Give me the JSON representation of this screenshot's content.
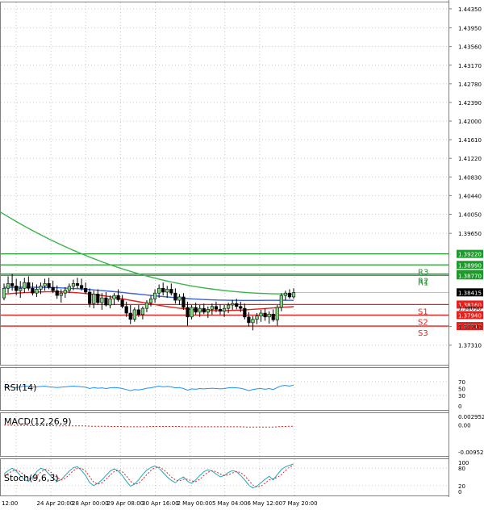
{
  "chart_data": {
    "type": "candlestick",
    "title": "",
    "price_axis": {
      "ylim": [
        1.369,
        1.445
      ],
      "ticks": [
        "1.44350",
        "1.43950",
        "1.43560",
        "1.43170",
        "1.42780",
        "1.42390",
        "1.42000",
        "1.41610",
        "1.41220",
        "1.40830",
        "1.40440",
        "1.40050",
        "1.39650",
        "1.37700",
        "1.37310"
      ]
    },
    "time_axis": {
      "ticks": [
        "12:00",
        "24 Apr 20:00",
        "28 Apr 00:00",
        "29 Apr 08:00",
        "30 Apr 16:00",
        "2 May 00:00",
        "5 May 04:00",
        "6 May 12:00",
        "7 May 20:00"
      ]
    },
    "candles": [
      [
        1.383,
        1.386,
        1.3825,
        1.385
      ],
      [
        1.385,
        1.3875,
        1.384,
        1.386
      ],
      [
        1.386,
        1.388,
        1.3845,
        1.3855
      ],
      [
        1.3855,
        1.387,
        1.3835,
        1.3845
      ],
      [
        1.3845,
        1.3865,
        1.383,
        1.385
      ],
      [
        1.385,
        1.3872,
        1.384,
        1.3862
      ],
      [
        1.3862,
        1.3875,
        1.3845,
        1.385
      ],
      [
        1.385,
        1.3862,
        1.3835,
        1.384
      ],
      [
        1.384,
        1.3858,
        1.3832,
        1.3848
      ],
      [
        1.3848,
        1.3862,
        1.3838,
        1.3855
      ],
      [
        1.3855,
        1.387,
        1.3845,
        1.386
      ],
      [
        1.386,
        1.3872,
        1.3848,
        1.3852
      ],
      [
        1.3852,
        1.3866,
        1.384,
        1.3845
      ],
      [
        1.3845,
        1.3856,
        1.3828,
        1.3835
      ],
      [
        1.3835,
        1.3848,
        1.382,
        1.384
      ],
      [
        1.384,
        1.3852,
        1.383,
        1.3846
      ],
      [
        1.3846,
        1.386,
        1.384,
        1.3854
      ],
      [
        1.3854,
        1.3868,
        1.3846,
        1.386
      ],
      [
        1.386,
        1.3872,
        1.385,
        1.3856
      ],
      [
        1.3856,
        1.387,
        1.3845,
        1.385
      ],
      [
        1.385,
        1.3862,
        1.3838,
        1.3842
      ],
      [
        1.3842,
        1.385,
        1.381,
        1.3818
      ],
      [
        1.3818,
        1.3845,
        1.3808,
        1.3838
      ],
      [
        1.3838,
        1.3848,
        1.3815,
        1.382
      ],
      [
        1.382,
        1.384,
        1.3805,
        1.383
      ],
      [
        1.383,
        1.3842,
        1.3812,
        1.3815
      ],
      [
        1.3815,
        1.3835,
        1.3808,
        1.3828
      ],
      [
        1.3828,
        1.384,
        1.3815,
        1.3835
      ],
      [
        1.3835,
        1.3848,
        1.3822,
        1.3826
      ],
      [
        1.3826,
        1.3836,
        1.3808,
        1.3812
      ],
      [
        1.3812,
        1.3822,
        1.379,
        1.3798
      ],
      [
        1.3798,
        1.3815,
        1.3775,
        1.3785
      ],
      [
        1.3785,
        1.381,
        1.378,
        1.3805
      ],
      [
        1.3805,
        1.3815,
        1.379,
        1.3795
      ],
      [
        1.3795,
        1.3812,
        1.3785,
        1.3808
      ],
      [
        1.3808,
        1.3825,
        1.38,
        1.382
      ],
      [
        1.382,
        1.3835,
        1.3812,
        1.3828
      ],
      [
        1.3828,
        1.3848,
        1.382,
        1.384
      ],
      [
        1.384,
        1.3858,
        1.383,
        1.385
      ],
      [
        1.385,
        1.3862,
        1.3835,
        1.3842
      ],
      [
        1.3842,
        1.3855,
        1.383,
        1.3848
      ],
      [
        1.3848,
        1.386,
        1.3835,
        1.384
      ],
      [
        1.384,
        1.385,
        1.3818,
        1.3825
      ],
      [
        1.3825,
        1.3838,
        1.3815,
        1.3832
      ],
      [
        1.3832,
        1.384,
        1.3805,
        1.381
      ],
      [
        1.381,
        1.3822,
        1.3772,
        1.379
      ],
      [
        1.379,
        1.3815,
        1.3785,
        1.381
      ],
      [
        1.381,
        1.382,
        1.3795,
        1.38
      ],
      [
        1.38,
        1.3815,
        1.379,
        1.3808
      ],
      [
        1.3808,
        1.3818,
        1.3796,
        1.38
      ],
      [
        1.38,
        1.3812,
        1.3788,
        1.3806
      ],
      [
        1.3806,
        1.3818,
        1.3795,
        1.3812
      ],
      [
        1.3812,
        1.3822,
        1.38,
        1.3806
      ],
      [
        1.3806,
        1.3816,
        1.3795,
        1.3802
      ],
      [
        1.3802,
        1.3815,
        1.379,
        1.3808
      ],
      [
        1.3808,
        1.382,
        1.3798,
        1.3815
      ],
      [
        1.3815,
        1.3826,
        1.3805,
        1.3818
      ],
      [
        1.3818,
        1.3828,
        1.3806,
        1.3812
      ],
      [
        1.3812,
        1.3822,
        1.38,
        1.3808
      ],
      [
        1.3808,
        1.3818,
        1.3785,
        1.379
      ],
      [
        1.379,
        1.38,
        1.377,
        1.3778
      ],
      [
        1.3778,
        1.3792,
        1.3762,
        1.3785
      ],
      [
        1.3785,
        1.3798,
        1.3775,
        1.3792
      ],
      [
        1.3792,
        1.3805,
        1.378,
        1.3798
      ],
      [
        1.3798,
        1.3808,
        1.3782,
        1.379
      ],
      [
        1.379,
        1.3802,
        1.3776,
        1.3796
      ],
      [
        1.3796,
        1.3806,
        1.378,
        1.3784
      ],
      [
        1.3784,
        1.3815,
        1.3772,
        1.381
      ],
      [
        1.381,
        1.384,
        1.3802,
        1.3835
      ],
      [
        1.3835,
        1.3845,
        1.3825,
        1.384
      ],
      [
        1.384,
        1.3848,
        1.3828,
        1.3832
      ],
      [
        1.3832,
        1.385,
        1.3828,
        1.3841
      ]
    ],
    "moving_averages": [
      {
        "color": "#3cb44b",
        "start": 1.401,
        "end": 1.3838
      },
      {
        "color": "#3a5fd9",
        "start": 1.3852,
        "end": 1.3822
      },
      {
        "color": "#e8201c",
        "start": 1.3838,
        "end": 1.3805
      }
    ],
    "levels": [
      {
        "label": "",
        "value": 1.3922,
        "value_label": "1.39220",
        "color": "#1e9a2c"
      },
      {
        "label": "R3",
        "value": 1.3899,
        "value_label": "1.38990",
        "color": "#1e9a2c"
      },
      {
        "label": "R2",
        "value": 1.388,
        "value_label": "1.38800",
        "color": "#1e9a2c"
      },
      {
        "label": "R1",
        "value": 1.3877,
        "value_label": "1.38770",
        "color": "#1e9a2c"
      },
      {
        "label": "S1",
        "value": 1.3816,
        "value_label": "1.38160",
        "color": "#e8201c"
      },
      {
        "label": "S2",
        "value": 1.3794,
        "value_label": "1.37940",
        "color": "#e8201c"
      },
      {
        "label": "S3",
        "value": 1.3771,
        "value_label": "1.37710",
        "color": "#e8201c"
      }
    ],
    "current_price": {
      "value": 1.38415,
      "label": "1.38415",
      "color": "#000000"
    },
    "extra_tick": {
      "value": 1.3809,
      "label": "1.38090"
    },
    "rsi": {
      "label": "RSI(14)",
      "ylim": [
        0,
        100
      ],
      "ticks": [
        "70",
        "50",
        "30",
        "0"
      ],
      "values": [
        55,
        56,
        54,
        53,
        55,
        57,
        56,
        54,
        55,
        56,
        57,
        55,
        54,
        53,
        54,
        55,
        56,
        57,
        56,
        55,
        54,
        50,
        53,
        51,
        52,
        50,
        52,
        53,
        52,
        50,
        47,
        44,
        47,
        46,
        48,
        51,
        52,
        55,
        57,
        55,
        56,
        55,
        52,
        53,
        50,
        45,
        49,
        48,
        50,
        49,
        50,
        51,
        50,
        49,
        50,
        52,
        53,
        52,
        51,
        48,
        44,
        47,
        49,
        50,
        48,
        50,
        47,
        53,
        58,
        59,
        57,
        60
      ]
    },
    "macd": {
      "label": "MACD(12,26,9)",
      "ticks": [
        "0.002952",
        "0.00",
        "-0.009528"
      ],
      "ylim": [
        -0.009528,
        0.002952
      ],
      "main": [
        -0.0001,
        -0.0001,
        -0.0002,
        -0.0002,
        -0.0002,
        -0.0002,
        -0.0002,
        -0.0003,
        -0.0003,
        -0.0003,
        -0.0003,
        -0.0003,
        -0.0003,
        -0.0004,
        -0.0004,
        -0.0004,
        -0.0004,
        -0.0004,
        -0.0004,
        -0.0004,
        -0.0004,
        -0.0005,
        -0.0005,
        -0.0005,
        -0.0005,
        -0.0005,
        -0.0006,
        -0.0006,
        -0.0006,
        -0.0006,
        -0.0007,
        -0.0007,
        -0.0007,
        -0.0007,
        -0.0007,
        -0.0007,
        -0.0006,
        -0.0006,
        -0.0006,
        -0.0006,
        -0.0006,
        -0.0006,
        -0.0006,
        -0.0006,
        -0.0007,
        -0.0007,
        -0.0007,
        -0.0007,
        -0.0007,
        -0.0007,
        -0.0007,
        -0.0007,
        -0.0007,
        -0.0007,
        -0.0007,
        -0.0007,
        -0.0007,
        -0.0007,
        -0.0007,
        -0.0008,
        -0.0008,
        -0.0008,
        -0.0008,
        -0.0008,
        -0.0008,
        -0.0008,
        -0.0008,
        -0.0007,
        -0.0006,
        -0.0006,
        -0.0005,
        -0.0005
      ]
    },
    "stoch": {
      "label": "Stoch(9,6,3)",
      "ylim": [
        0,
        100
      ],
      "ticks": [
        "100",
        "80",
        "20",
        "0"
      ],
      "k": [
        60,
        72,
        80,
        70,
        55,
        40,
        35,
        50,
        68,
        80,
        75,
        60,
        45,
        35,
        40,
        55,
        70,
        82,
        85,
        72,
        55,
        30,
        20,
        28,
        40,
        55,
        70,
        78,
        70,
        55,
        35,
        18,
        25,
        40,
        58,
        74,
        82,
        88,
        80,
        65,
        50,
        38,
        30,
        42,
        50,
        35,
        28,
        40,
        55,
        68,
        75,
        70,
        60,
        50,
        55,
        65,
        72,
        68,
        55,
        40,
        22,
        12,
        18,
        30,
        42,
        52,
        40,
        58,
        75,
        85,
        90,
        95
      ],
      "d": [
        55,
        62,
        70,
        74,
        68,
        55,
        45,
        42,
        52,
        66,
        76,
        72,
        60,
        48,
        40,
        45,
        58,
        72,
        80,
        80,
        70,
        50,
        32,
        25,
        30,
        42,
        56,
        68,
        73,
        68,
        53,
        35,
        25,
        28,
        42,
        58,
        72,
        82,
        84,
        76,
        64,
        50,
        40,
        36,
        42,
        42,
        36,
        34,
        42,
        55,
        66,
        72,
        68,
        60,
        55,
        57,
        64,
        68,
        65,
        54,
        38,
        22,
        15,
        18,
        28,
        40,
        44,
        48,
        58,
        72,
        84,
        90
      ]
    }
  }
}
